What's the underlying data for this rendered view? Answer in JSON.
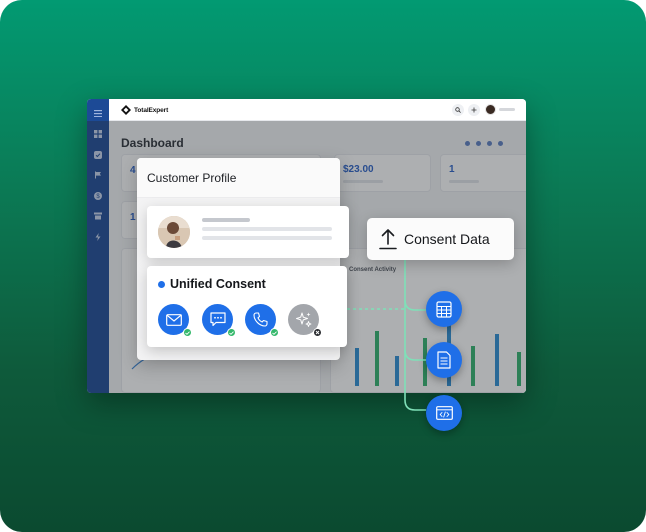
{
  "app": {
    "brand_name": "TotalExpert",
    "page_title": "Dashboard",
    "kpi_values": [
      "$23.00",
      "1"
    ]
  },
  "profile": {
    "title": "Customer Profile"
  },
  "consent": {
    "title": "Unified Consent",
    "channels": [
      {
        "icon": "email-icon",
        "status": "granted"
      },
      {
        "icon": "sms-icon",
        "status": "granted"
      },
      {
        "icon": "phone-icon",
        "status": "granted"
      },
      {
        "icon": "ai-sparkle-icon",
        "status": "denied"
      }
    ]
  },
  "export": {
    "label": "Consent Data"
  },
  "destinations": [
    "spreadsheet-icon",
    "document-icon",
    "code-window-icon"
  ],
  "colors": {
    "background_top": "#029a72",
    "background_bottom": "#0b4a30",
    "sidebar": "#1c4a96",
    "accent_blue": "#1f6fe8",
    "connector": "#7fe0b8",
    "status_green": "#34b86b"
  }
}
